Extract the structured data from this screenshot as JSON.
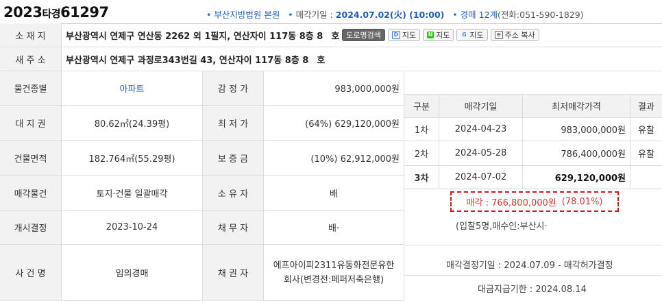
{
  "header": {
    "case_year": "2023",
    "case_type": "타경",
    "case_num": "61297",
    "court": "부산지방법원 본원",
    "sale_date_label": "매각기일 : ",
    "sale_date": "2024.07.02(火) (10:00)",
    "dept": "경매 12계",
    "phone": "(전화:051-590-1829)"
  },
  "address": {
    "label": "소 재 지",
    "value": "부산광역시 연제구 연산동 2262 외 1필지, 연산자이 117동 8층 8",
    "unit": "호",
    "btn_road": "도로명검색",
    "btn_daum": "지도",
    "btn_naver": "지도",
    "btn_google": "지도",
    "btn_copy": "주소 복사"
  },
  "new_address": {
    "label": "새 주 소",
    "value": "부산광역시 연제구 과정로343번길 43, 연산자이 117동 8층 8",
    "unit": "호"
  },
  "rows": [
    {
      "label": "물건종별",
      "value": "아파트",
      "label2": "감 정 가",
      "value2": "983,000,000원"
    },
    {
      "label": "대 지 권",
      "value": "80.62㎡(24.39평)",
      "label2": "최 저 가",
      "value2": "(64%) 629,120,000원"
    },
    {
      "label": "건물면적",
      "value": "182.764㎡(55.29평)",
      "label2": "보 증 금",
      "value2": "(10%) 62,912,000원"
    },
    {
      "label": "매각물건",
      "value": "토지·건물 일괄매각",
      "label2": "소 유 자",
      "value2": "배"
    },
    {
      "label": "개시결정",
      "value": "2023-10-24",
      "label2": "채 무 자",
      "value2": "배·"
    },
    {
      "label": "사 건 명",
      "value": "임의경매",
      "label2": "채 권 자",
      "value2a": "에프아이피2311유동화전문유한",
      "value2b": "회사(변경전:페퍼저축은행)"
    }
  ],
  "history": {
    "headers": [
      "구분",
      "매각기일",
      "최저매각가격",
      "결과"
    ],
    "rows": [
      {
        "round": "1차",
        "date": "2024-04-23",
        "price": "983,000,000원",
        "result": "유찰"
      },
      {
        "round": "2차",
        "date": "2024-05-28",
        "price": "786,400,000원",
        "result": "유찰"
      },
      {
        "round": "3차",
        "date": "2024-07-02",
        "price": "629,120,000원",
        "result": ""
      }
    ],
    "sale_text": "매각 : 766,800,000원",
    "sale_pct": "(78.01%)",
    "bidders": "(입찰5명,매수인:부산시·",
    "decision": "매각결정기일 : 2024.07.09 - 매각허가결정",
    "payment": "대금지급기한 : 2024.08.14"
  }
}
